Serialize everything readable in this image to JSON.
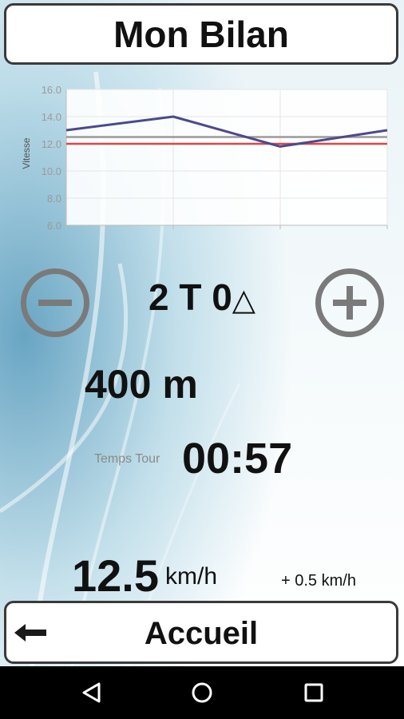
{
  "header": {
    "title": "Mon Bilan"
  },
  "chart_data": {
    "type": "line",
    "ylabel": "Vitesse",
    "ylim": [
      6.0,
      16.0
    ],
    "yticks": [
      "16.0",
      "14.0",
      "12.0",
      "10.0",
      "8.0",
      "6.0"
    ],
    "x": [
      1,
      2,
      3,
      4
    ],
    "series": [
      {
        "values": [
          13.0,
          14.0,
          11.8,
          13.0
        ],
        "color": "#4b4a8c"
      },
      {
        "values": [
          12.0,
          12.0,
          12.0,
          12.0
        ],
        "color": "#e24545"
      },
      {
        "values": [
          12.5,
          12.5,
          12.5,
          12.5
        ],
        "color": "#9a9a9a"
      }
    ],
    "grid": true
  },
  "lap_setting": {
    "value": "2 T 0",
    "symbol": "△"
  },
  "distance": "400 m",
  "lap": {
    "label": "Temps Tour",
    "time": "00:57"
  },
  "speed": {
    "value": "12.5",
    "unit": "km/h",
    "delta": "+ 0.5 km/h"
  },
  "footer": {
    "home_label": "Accueil"
  },
  "icons": {
    "minus": "minus-circle-icon",
    "plus": "plus-circle-icon",
    "back": "back-arrow-icon",
    "nav_back": "triangle-back-icon",
    "nav_home": "circle-home-icon",
    "nav_recent": "square-recent-icon"
  }
}
